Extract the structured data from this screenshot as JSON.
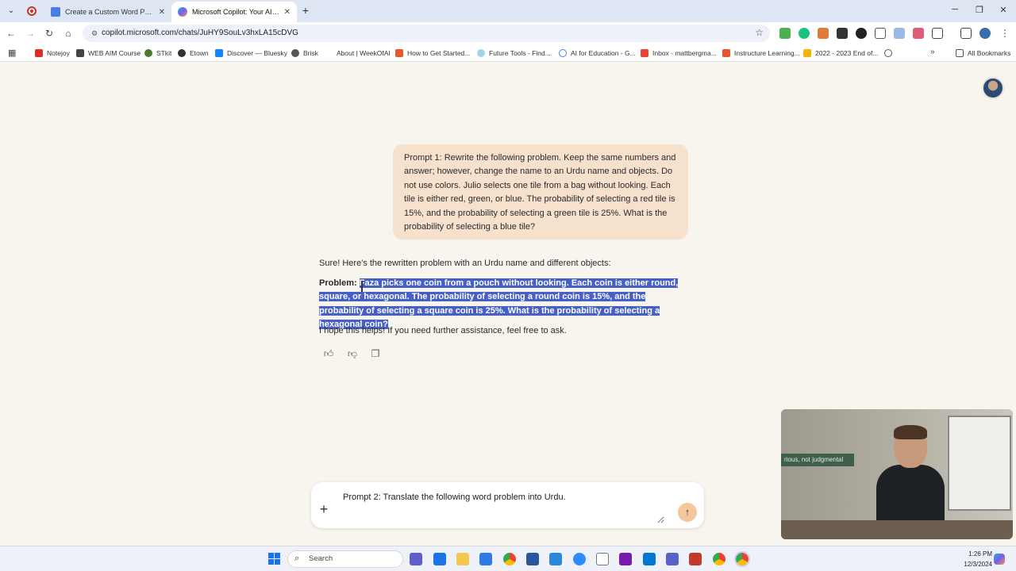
{
  "browser": {
    "tabs": [
      {
        "title": "Create a Custom Word Problem",
        "favicon_color": "#4a7de0"
      },
      {
        "title": "Microsoft Copilot: Your AI companion",
        "favicon_color": "#27b0d8",
        "active": true
      }
    ],
    "address_url": "copilot.microsoft.com/chats/JuHY9SouLv3hxLA15cDVG",
    "bookmarks": [
      "Notejoy",
      "WEB AIM Course",
      "STkit",
      "Etown",
      "Discover — Bluesky",
      "Brisk",
      "About | WeekOfAI",
      "How to Get Started...",
      "Future Tools - Find...",
      "AI for Education - G...",
      "Inbox - mattbergma...",
      "Instructure Learning...",
      "2022 - 2023 End of..."
    ],
    "all_bookmarks_label": "All Bookmarks"
  },
  "chat": {
    "user_prompt": "Prompt 1:  Rewrite the following problem. Keep the same numbers and answer; however, change the name to an Urdu name and objects. Do not use colors. Julio selects one tile from a bag without looking. Each tile is either red, green, or blue. The probability of selecting a red tile is 15%, and the probability of selecting a green tile is 25%. What is the probability of selecting a blue tile?",
    "reply_intro": "Sure! Here's the rewritten problem with an Urdu name and different objects:",
    "problem_label": "Problem:",
    "problem_text": "Faza picks one coin from a pouch without looking. Each coin is either round, square, or hexagonal. The probability of selecting a round coin is 15%, and the probability of selecting a square coin is 25%. What is the probability of selecting a hexagonal coin?",
    "reply_outro": "I hope this helps! If you need further assistance, feel free to ask."
  },
  "composer": {
    "value": "Prompt 2: Translate the following word problem into Urdu."
  },
  "webcam": {
    "sign_text": "rious, not judgmental"
  },
  "taskbar": {
    "search_label": "Search",
    "time": "1:26 PM",
    "date": "12/3/2024"
  }
}
